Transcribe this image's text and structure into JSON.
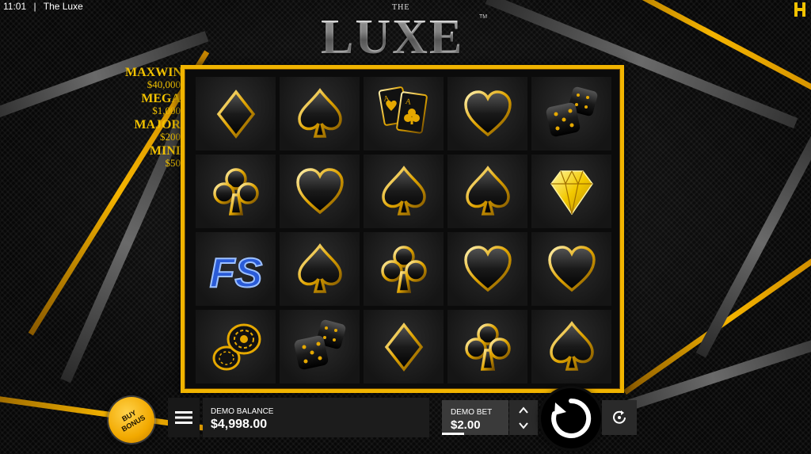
{
  "status_bar": {
    "time": "11:01",
    "separator": "|",
    "app_name": "The Luxe"
  },
  "provider_logo": {
    "icon": "hacksaw-h-icon",
    "color": "#f2c200"
  },
  "title": {
    "the": "THE",
    "main": "LUXE",
    "trademark": "TM"
  },
  "jackpots": [
    {
      "name": "MAXWIN",
      "value": "$40,000"
    },
    {
      "name": "MEGA",
      "value": "$1,000"
    },
    {
      "name": "MAJOR",
      "value": "$200"
    },
    {
      "name": "MINI",
      "value": "$50"
    }
  ],
  "reels": [
    [
      "diamond",
      "spade",
      "aces",
      "heart",
      "dice"
    ],
    [
      "club",
      "heart",
      "spade",
      "spade",
      "gem"
    ],
    [
      "free-spins",
      "spade",
      "club",
      "heart",
      "heart"
    ],
    [
      "chips",
      "dice",
      "diamond",
      "club",
      "spade"
    ]
  ],
  "free_spins_text": "FS",
  "controls": {
    "buy_bonus": "BUY BONUS",
    "balance_label": "DEMO BALANCE",
    "balance_value": "$4,998.00",
    "bet_label": "DEMO BET",
    "bet_value": "$2.00"
  },
  "colors": {
    "gold": "#f1b400",
    "frame_gold": "#f1b400",
    "accent_blue": "#2a5bd7"
  }
}
